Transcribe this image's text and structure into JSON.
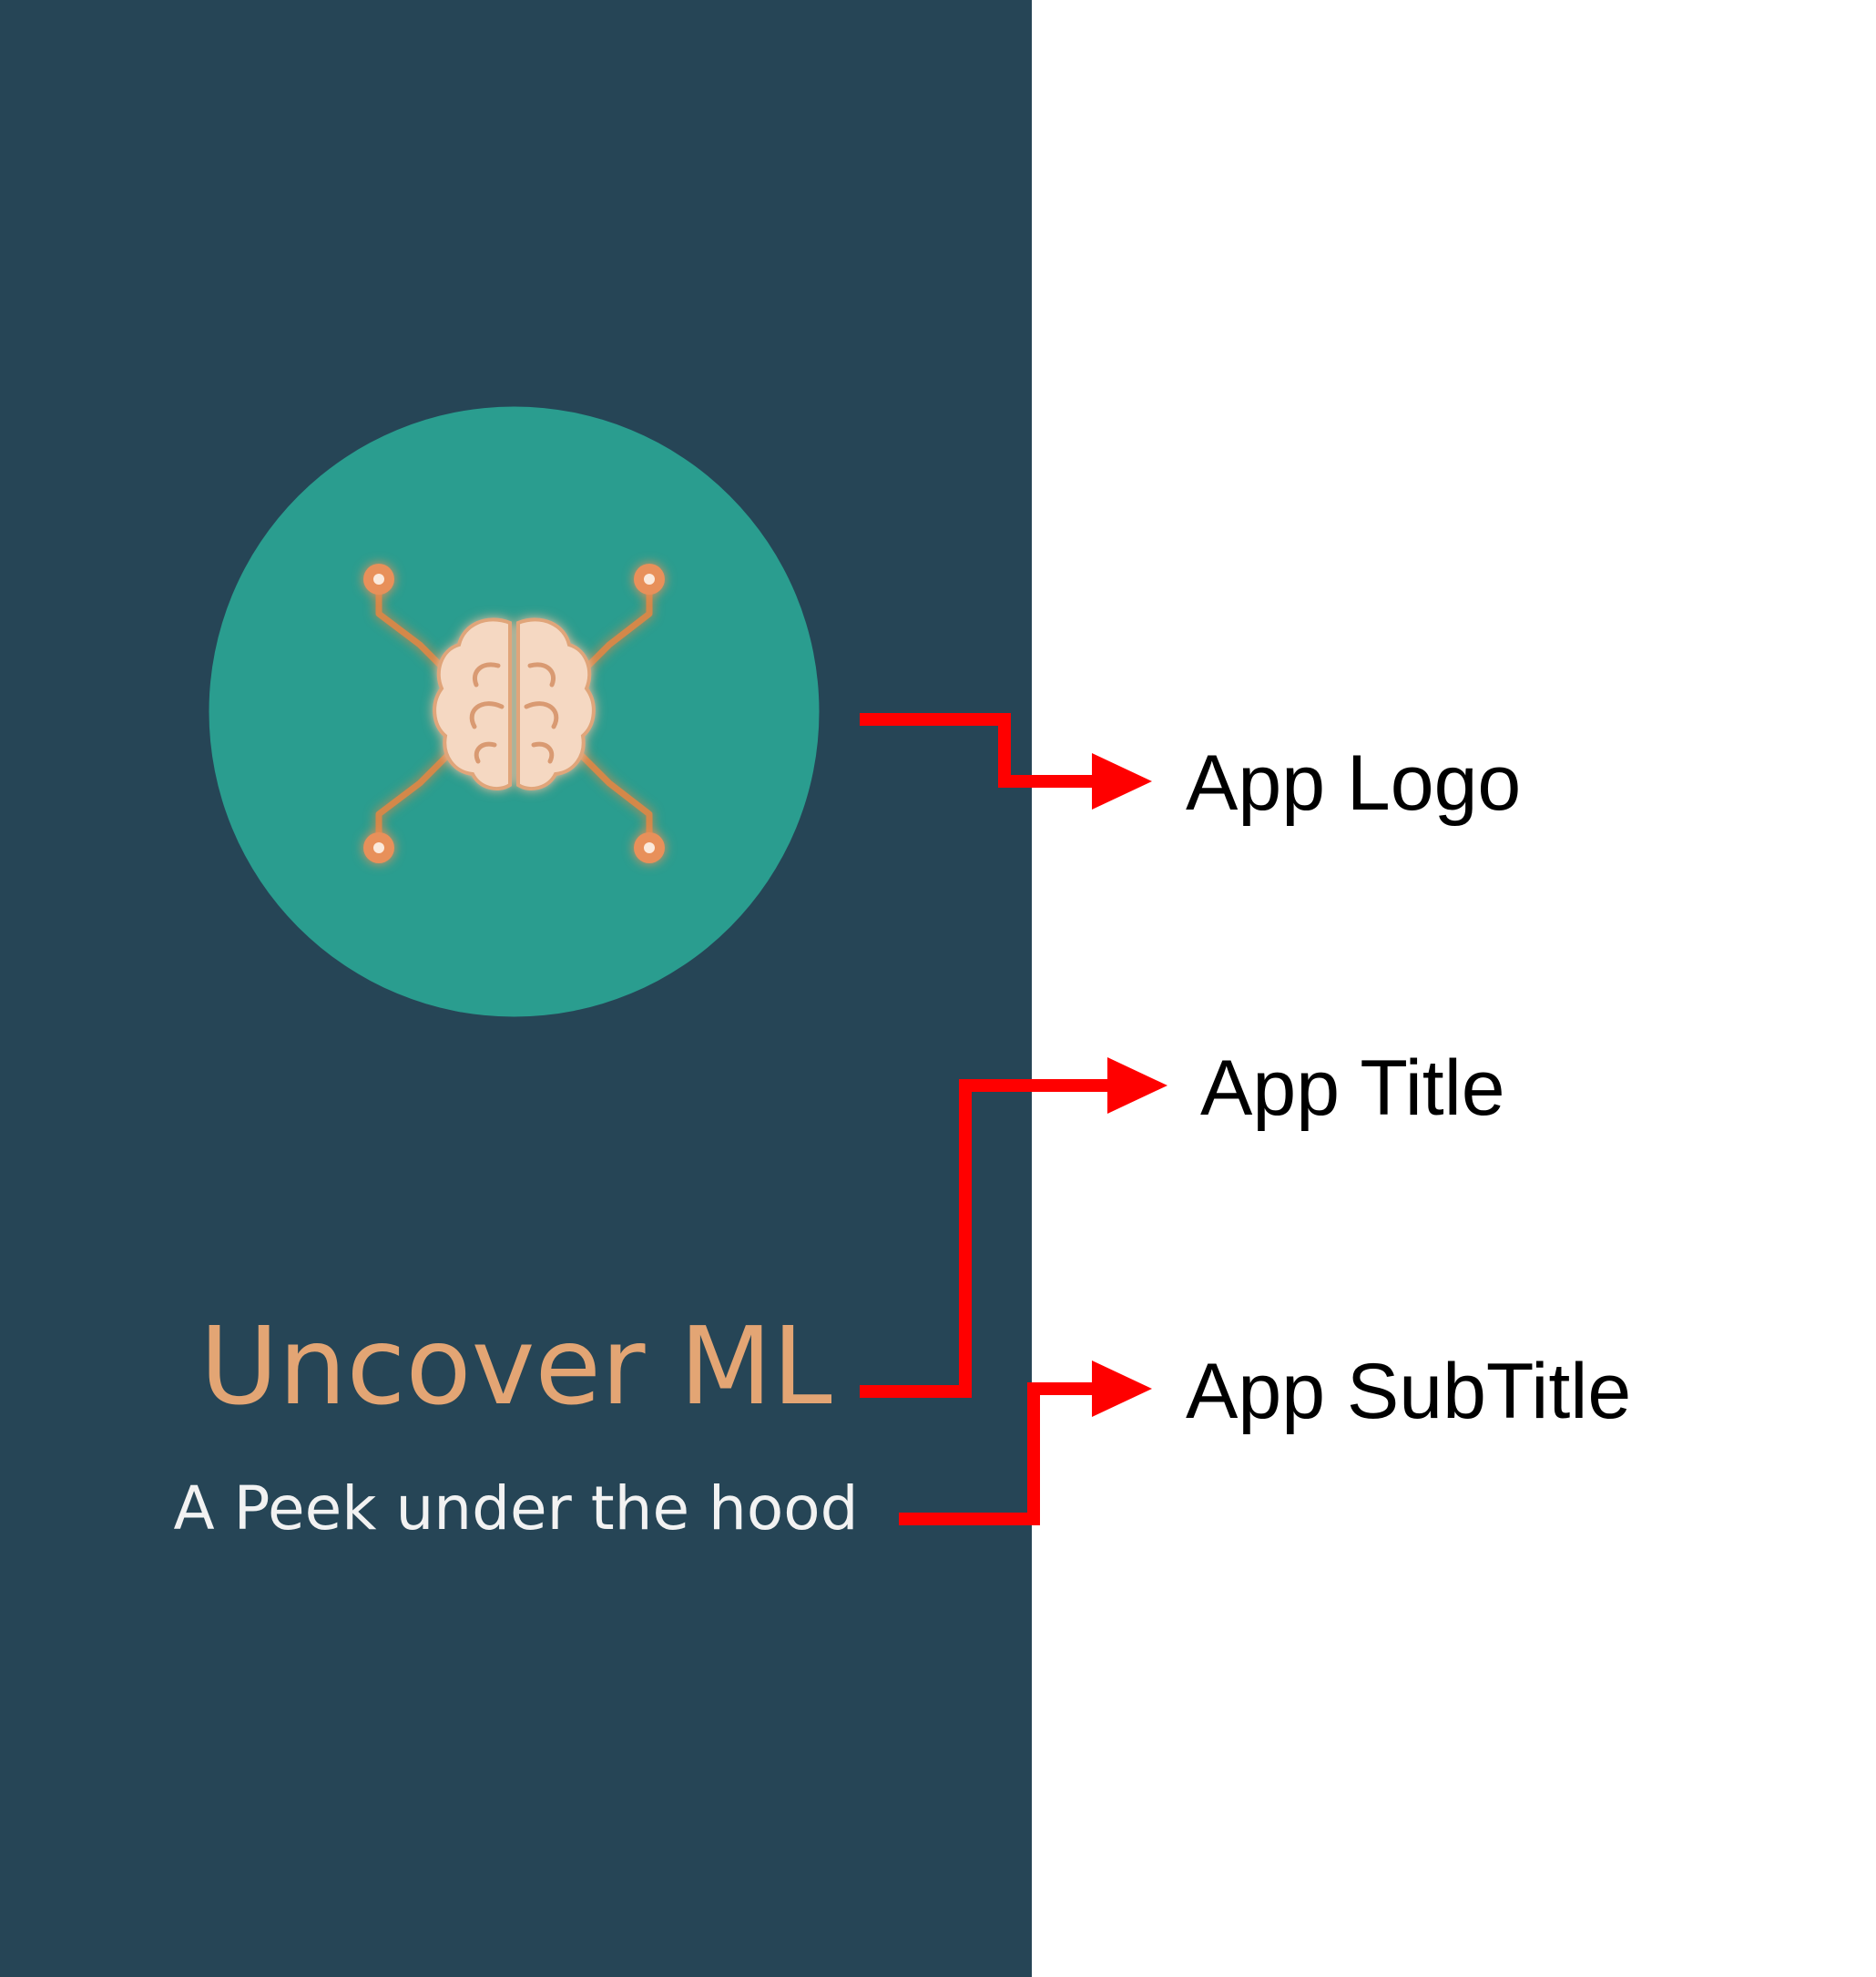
{
  "app": {
    "title": "Uncover ML",
    "subtitle": "A Peek under the hood",
    "logo_icon": "brain-circuit-icon"
  },
  "annotations": {
    "logo_label": "App Logo",
    "title_label": "App Title",
    "subtitle_label": "App SubTitle"
  },
  "colors": {
    "panel_background": "#264556",
    "logo_circle": "#2a9d8f",
    "title": "#e3a574",
    "subtitle": "#f2f2f2",
    "brain": "#f5d8c2",
    "circuit": "#d4884a",
    "arrow": "#ff0000"
  }
}
